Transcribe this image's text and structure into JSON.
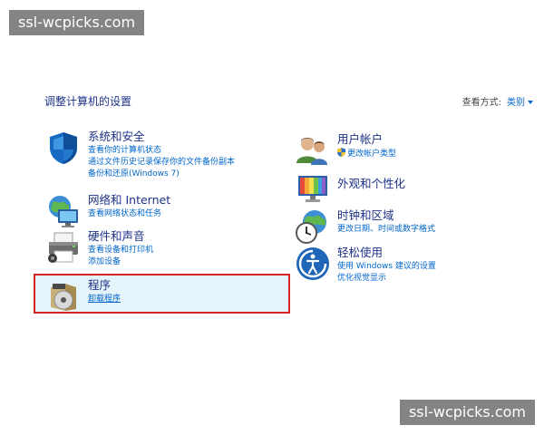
{
  "watermark": "ssl-wcpicks.com",
  "header": {
    "title": "调整计算机的设置",
    "view_by_label": "查看方式:",
    "view_by_value": "类别"
  },
  "categories_left": [
    {
      "title": "系统和安全",
      "links": [
        "查看你的计算机状态",
        "通过文件历史记录保存你的文件备份副本",
        "备份和还原(Windows 7)"
      ]
    },
    {
      "title": "网络和 Internet",
      "links": [
        "查看网络状态和任务"
      ]
    },
    {
      "title": "硬件和声音",
      "links": [
        "查看设备和打印机",
        "添加设备"
      ]
    },
    {
      "title": "程序",
      "links": [
        "卸载程序"
      ]
    }
  ],
  "categories_right": [
    {
      "title": "用户帐户",
      "links": [
        "更改帐户类型"
      ]
    },
    {
      "title": "外观和个性化",
      "links": []
    },
    {
      "title": "时钟和区域",
      "links": [
        "更改日期、时间或数字格式"
      ]
    },
    {
      "title": "轻松使用",
      "links": [
        "使用 Windows 建议的设置",
        "优化视觉显示"
      ]
    }
  ],
  "colors": {
    "title_blue": "#1e3287",
    "link_blue": "#0066cc",
    "highlight_border": "#d62525",
    "highlight_fill": "#e5f3fb"
  },
  "icons": [
    "shield-icon",
    "network-icon",
    "printer-icon",
    "programs-icon",
    "users-icon",
    "appearance-icon",
    "clock-globe-icon",
    "ease-of-access-icon"
  ]
}
